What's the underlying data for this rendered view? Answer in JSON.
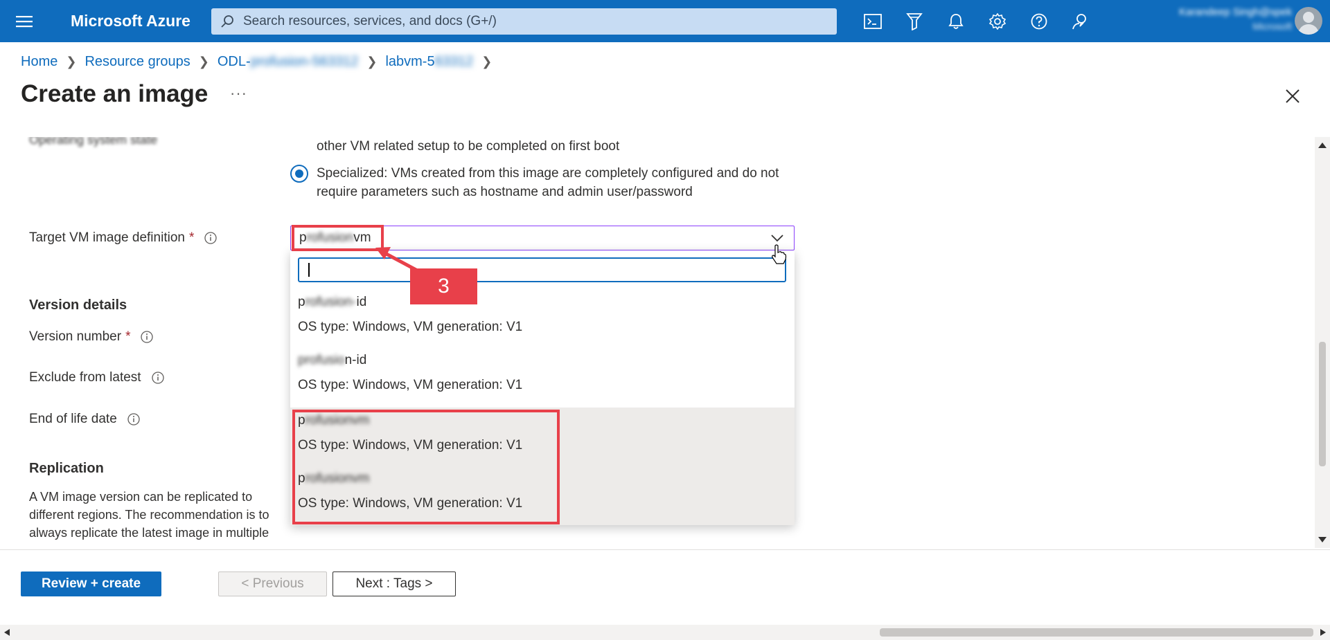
{
  "topbar": {
    "brand": "Microsoft Azure",
    "search_placeholder": "Search resources, services, and docs (G+/)",
    "icons": [
      "cloud-shell-icon",
      "directory-filter-icon",
      "notifications-icon",
      "settings-icon",
      "help-icon",
      "feedback-icon"
    ],
    "user_name": "Karandeep Singh@spek",
    "user_sub": "Microsoft"
  },
  "breadcrumb": {
    "items": [
      {
        "label": "Home"
      },
      {
        "label": "Resource groups"
      },
      {
        "label": "ODL-",
        "blurred": "profusion-563312"
      },
      {
        "label": "labvm-5",
        "blurred": "63312"
      }
    ]
  },
  "page": {
    "title": "Create an image",
    "more": "···"
  },
  "form": {
    "partial_top_label": "Operating system state",
    "generalized_tail": "other VM related setup to be completed on first boot",
    "specialized_text": "Specialized: VMs created from this image are completely configured and do not require parameters such as hostname and admin user/password",
    "target_label": "Target VM image definition",
    "required_mark": "*",
    "dropdown_value_prefix": "p",
    "dropdown_value_blur": "rofusion",
    "dropdown_value_suffix": "vm",
    "version_details": "Version details",
    "version_number_label": "Version number",
    "exclude_label": "Exclude from latest",
    "eol_label": "End of life date",
    "replication_heading": "Replication",
    "replication_text": "A VM image version can be replicated to different regions. The recommendation is to always replicate the latest image in multiple regions and to save on storage costs for VM image versions."
  },
  "dropdown": {
    "options": [
      {
        "prefix": "p",
        "blur": "rofusion-",
        "suffix": "id",
        "meta": "OS type: Windows, VM generation: V1"
      },
      {
        "prefix": "",
        "blur": "profusio",
        "suffix": "n-id",
        "meta": "OS type: Windows, VM generation: V1"
      },
      {
        "prefix": "p",
        "blur": "rofusionvm",
        "suffix": "",
        "meta": "OS type: Windows, VM generation: V1"
      },
      {
        "prefix": "p",
        "blur": "rofusionvm",
        "suffix": "",
        "meta": "OS type: Windows, VM generation: V1"
      }
    ]
  },
  "callout": {
    "number": "3"
  },
  "footer": {
    "review_create": "Review + create",
    "previous": "< Previous",
    "next": "Next : Tags >"
  },
  "colors": {
    "azure_blue": "#0f6cbd",
    "annotation_red": "#e8404a"
  }
}
